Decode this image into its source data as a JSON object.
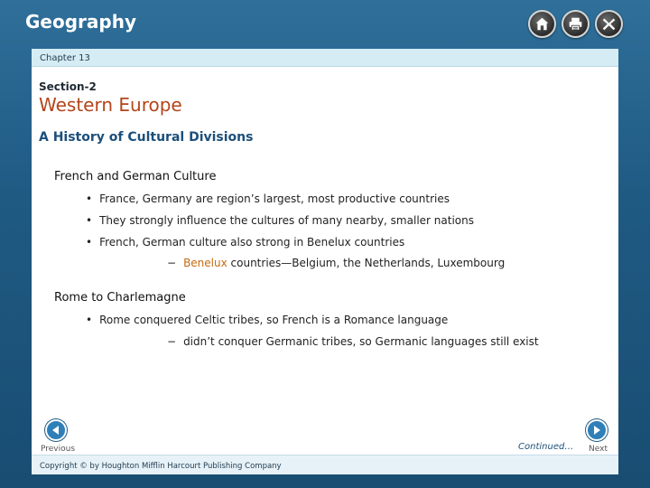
{
  "header": {
    "title": "Geography",
    "icons": [
      "home-icon",
      "print-icon",
      "close-icon"
    ]
  },
  "chapter_bar": {
    "label": "Chapter 13"
  },
  "content": {
    "section": "Section-2",
    "title": "Western Europe",
    "subtitle": "A History of Cultural Divisions",
    "topics": [
      {
        "heading": "French and German Culture",
        "bullets": [
          "France, Germany are region’s largest, most productive countries",
          "They strongly influence the cultures of many nearby, smaller nations",
          "French, German culture also strong in Benelux countries"
        ],
        "sub": {
          "dash": "−",
          "term": "Benelux",
          "rest": " countries—Belgium, the Netherlands, Luxembourg"
        }
      },
      {
        "heading": "Rome to Charlemagne",
        "bullets": [
          "Rome conquered Celtic tribes, so French is a Romance language"
        ],
        "sub": {
          "dash": "−",
          "text": "didn’t conquer Germanic tribes, so Germanic languages still exist"
        }
      }
    ],
    "bullet_glyph": "•"
  },
  "nav": {
    "previous_label": "Previous",
    "next_label": "Next",
    "continued": "Continued…"
  },
  "footer": {
    "copyright": "Copyright © by Houghton Mifflin Harcourt Publishing Company"
  },
  "colors": {
    "title_accent": "#b4451a",
    "subtitle_blue": "#1c4f7a",
    "term_orange": "#c46a10",
    "frame_blue": "#1f5a83"
  }
}
